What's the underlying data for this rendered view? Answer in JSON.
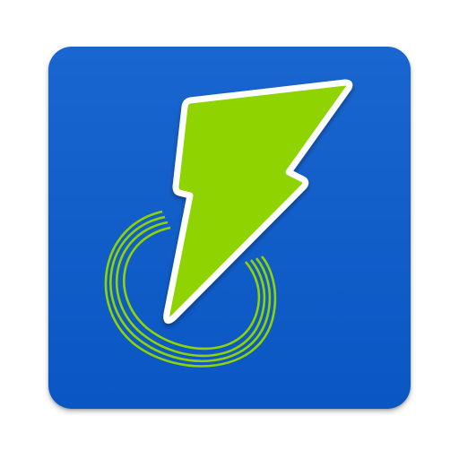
{
  "icon": {
    "name": "lightning-bolt-power-icon",
    "background_color": "#0a56c2",
    "background_highlight": "#1a66d0",
    "bolt_fill": "#8fd400",
    "bolt_outline": "#ffffff",
    "ring_color": "#8fd400"
  }
}
